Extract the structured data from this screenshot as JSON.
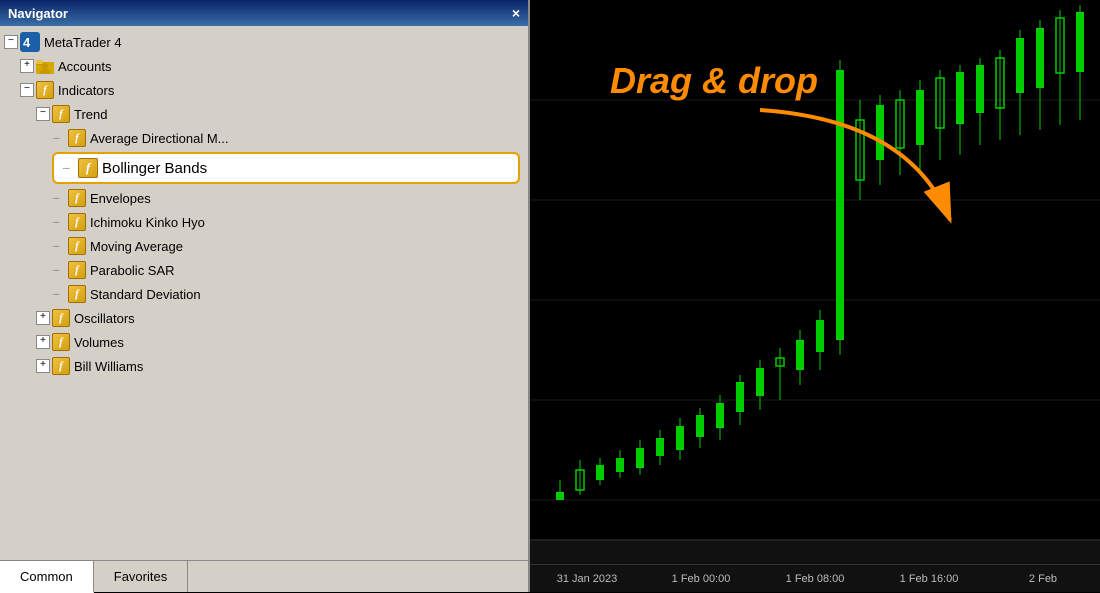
{
  "navigator": {
    "title": "Navigator",
    "close_btn": "×",
    "tree": {
      "metatrader_label": "MetaTrader 4",
      "accounts_label": "Accounts",
      "indicators_label": "Indicators",
      "trend_label": "Trend",
      "ama_label": "Average Directional M...",
      "bollinger_label": "Bollinger Bands",
      "envelopes_label": "Envelopes",
      "ichimoku_label": "Ichimoku Kinko Hyo",
      "moving_avg_label": "Moving Average",
      "parabolic_label": "Parabolic SAR",
      "std_dev_label": "Standard Deviation",
      "oscillators_label": "Oscillators",
      "volumes_label": "Volumes",
      "bill_williams_label": "Bill Williams"
    },
    "tabs": {
      "common": "Common",
      "favorites": "Favorites"
    }
  },
  "chart": {
    "drag_drop_text": "Drag & drop",
    "time_labels": [
      "31 Jan 2023",
      "1 Feb 00:00",
      "1 Feb 08:00",
      "1 Feb 16:00",
      "2 Feb"
    ]
  },
  "icons": {
    "func": "f",
    "expand": "+",
    "collapse": "−",
    "close": "×"
  }
}
